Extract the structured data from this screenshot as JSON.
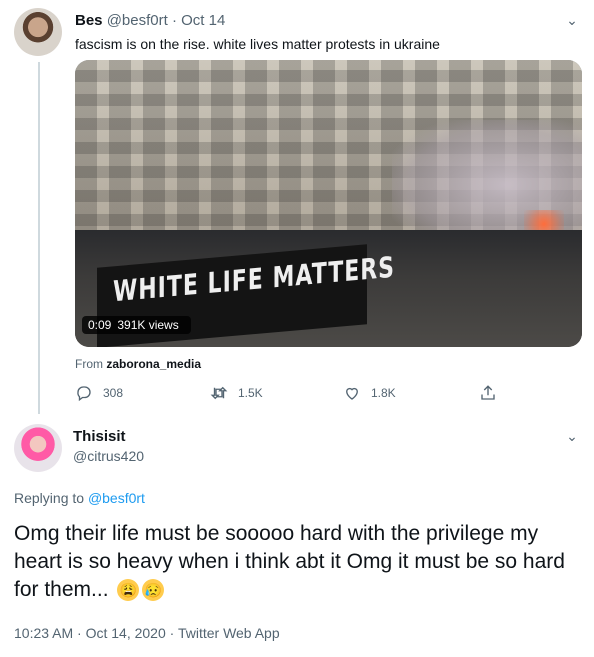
{
  "tweet1": {
    "name": "Bes",
    "handle": "@besf0rt",
    "sep": "·",
    "date": "Oct 14",
    "text": "fascism is on the rise. white lives matter protests in ukraine",
    "media": {
      "duration": "0:09",
      "views": "391K views",
      "banner_text": "WHITE LIFE MATTERS"
    },
    "from_label": "From",
    "from_source": "zaborona_media",
    "replies": "308",
    "retweets": "1.5K",
    "likes": "1.8K",
    "icons": [
      "chevron-down-icon",
      "reply-icon",
      "retweet-icon",
      "like-icon",
      "share-icon"
    ]
  },
  "tweet2": {
    "name": "Thisisit",
    "handle": "@citrus420",
    "replying_label": "Replying to",
    "replying_handle": "@besf0rt",
    "text": "Omg their life must be sooooo hard with the privilege my heart is so heavy when i think abt it Omg it must be so hard for them...",
    "emojis": [
      "😩",
      "😥"
    ],
    "meta": "10:23 AM · Oct 14, 2020 · Twitter Web App"
  },
  "colors": {
    "accent": "#1d9bf0",
    "muted": "#536471",
    "line": "#cfd9de"
  }
}
